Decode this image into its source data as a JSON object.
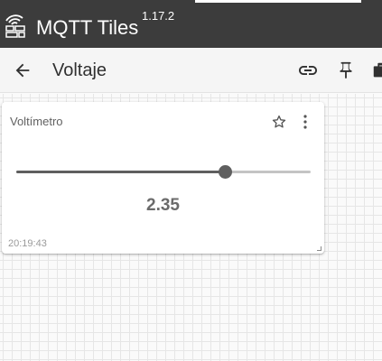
{
  "app": {
    "title": "MQTT Tiles",
    "version": "1.17.2",
    "logo_icon": "dashboard-tiles-icon"
  },
  "toolbar": {
    "back_icon": "arrow-left-icon",
    "title": "Voltaje",
    "link_icon": "link-icon",
    "pin_icon": "pin-icon",
    "more_icon": "briefcase-icon"
  },
  "tile": {
    "title": "Voltímetro",
    "star_icon": "star-outline-icon",
    "menu_icon": "more-vertical-icon",
    "value": "2.35",
    "slider_fraction": 0.71,
    "timestamp": "20:19:43"
  },
  "colors": {
    "app_bar": "#3c3c3c",
    "toolbar": "#f5f5f5",
    "slider_active": "#5f5f5f",
    "slider_inactive": "#c4c4c4"
  }
}
